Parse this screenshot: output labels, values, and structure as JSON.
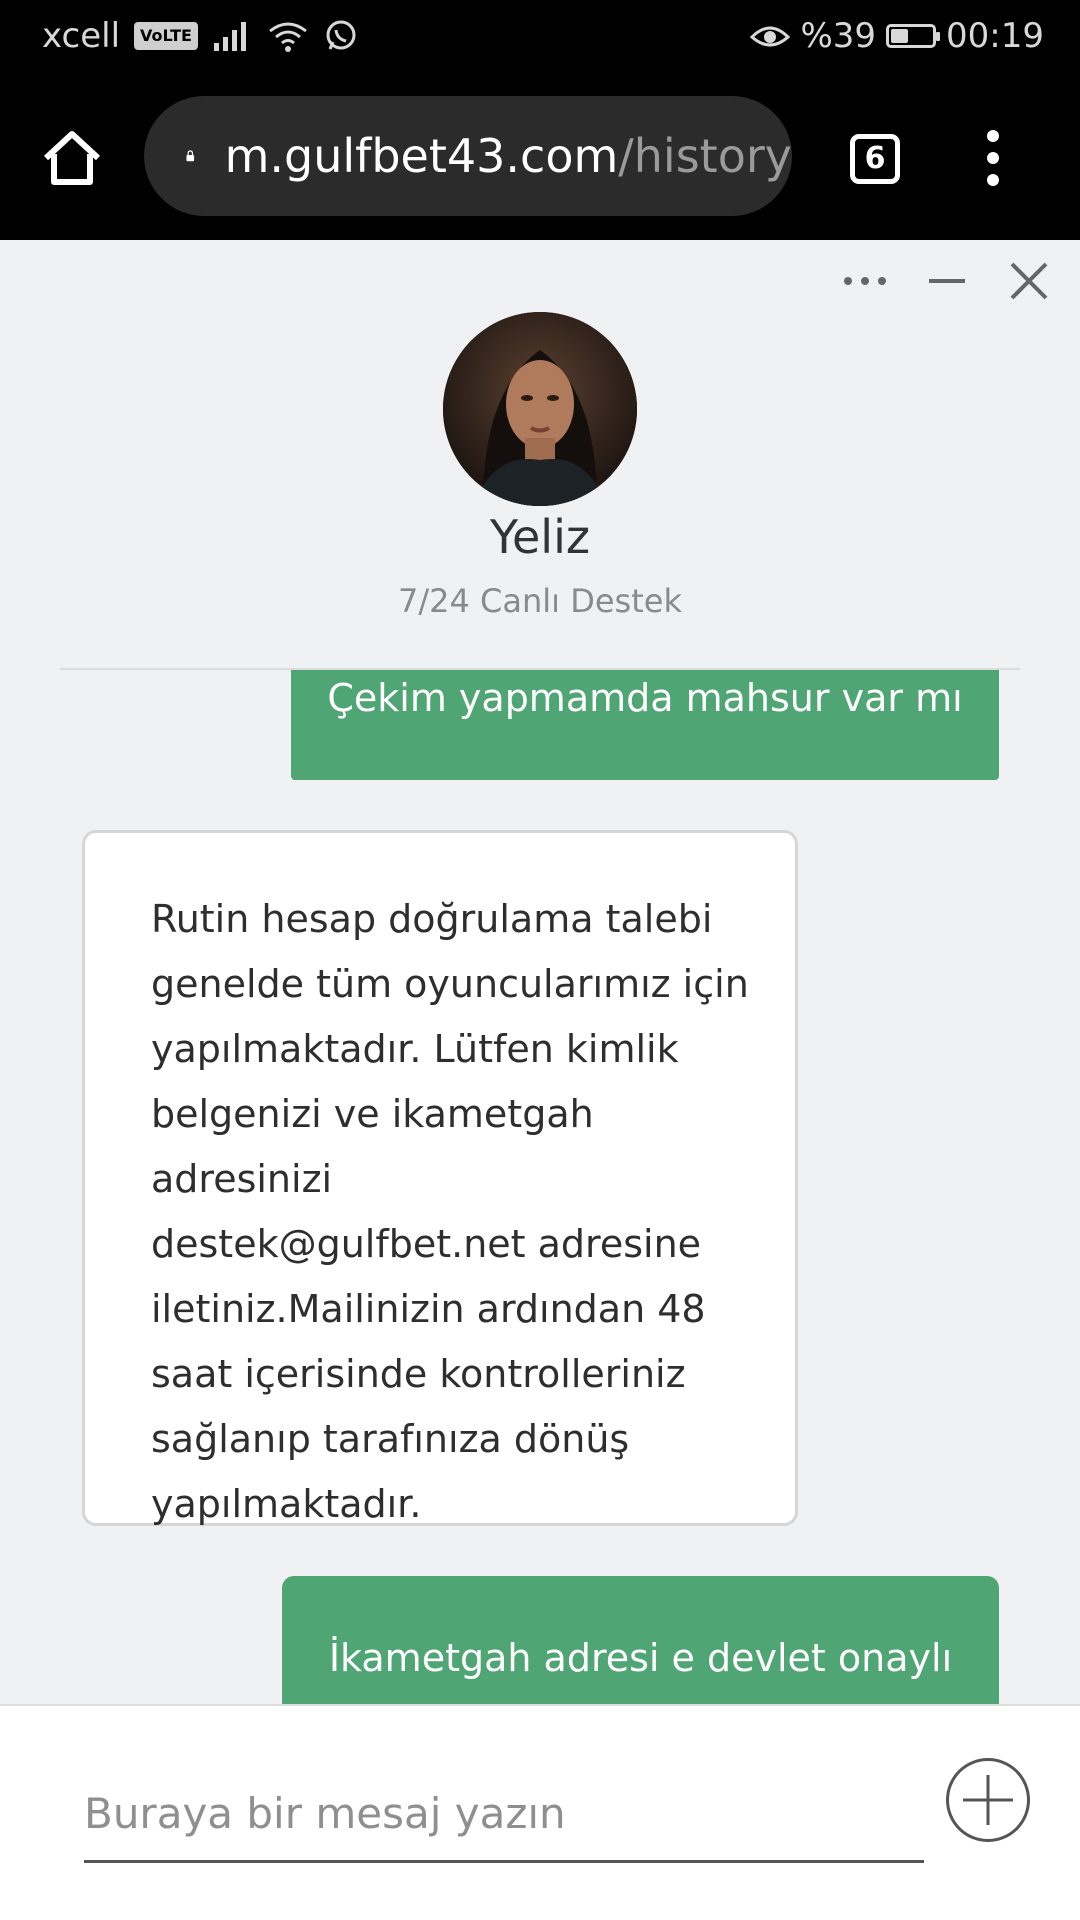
{
  "status_bar": {
    "carrier": "xcell",
    "volte": "VoLTE",
    "battery_percent": "%39",
    "battery_level": 0.39,
    "time": "00:19",
    "icons": [
      "signal-icon",
      "wifi-icon",
      "whatsapp-icon",
      "eye-icon",
      "battery-icon"
    ]
  },
  "browser": {
    "url_host": "m.gulfbet43.com",
    "url_path": "/history",
    "tab_count": "6"
  },
  "chat": {
    "agent_name": "Yeliz",
    "agent_role": "7/24 Canlı Destek",
    "messages": [
      {
        "from": "user",
        "text": "Çekim yapmamda mahsur var mı"
      },
      {
        "from": "agent",
        "text": "Rutin hesap doğrulama talebi\ngenelde tüm oyuncularımız için\nyapılmaktadır. Lütfen kimlik\nbelgenizi ve ikametgah adresinizi\ndestek@gulfbet.net adresine\niletiniz.Mailinizin ardından 48\nsaat içerisinde kontrolleriniz\nsağlanıp tarafınıza dönüş\nyapılmaktadır."
      },
      {
        "from": "user",
        "text": "İkametgah adresi e devlet onaylı"
      }
    ],
    "composer_placeholder": "Buraya bir mesaj yazın"
  },
  "colors": {
    "user_bubble": "#50a574",
    "chat_background": "#f0f1f3",
    "browser_bar": "#000000"
  }
}
